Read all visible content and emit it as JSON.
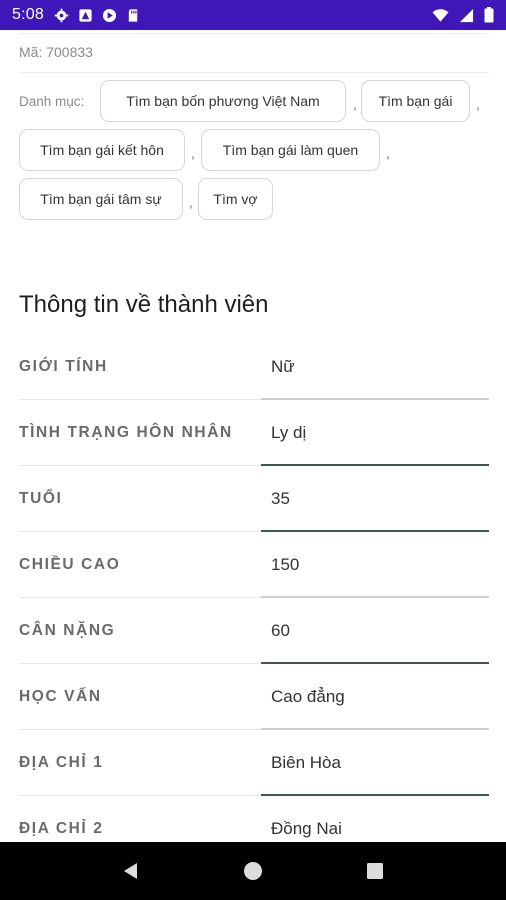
{
  "status_bar": {
    "time": "5:08"
  },
  "listing": {
    "code": "Mã: 700833",
    "category_label": "Danh mục:",
    "categories": [
      "Tìm bạn bốn phương Việt Nam",
      "Tìm bạn gái",
      "Tìm bạn gái kết hôn",
      "Tìm bạn gái làm quen",
      "Tìm bạn gái tâm sự",
      "Tìm vợ"
    ],
    "separator": ","
  },
  "member_info": {
    "title": "Thông tin về thành viên",
    "rows": [
      {
        "label": "GIỚI TÍNH",
        "value": "Nữ"
      },
      {
        "label": "TÌNH TRẠNG HÔN NHÂN",
        "value": "Ly dị"
      },
      {
        "label": "TUỔI",
        "value": "35"
      },
      {
        "label": "CHIỀU CAO",
        "value": "150"
      },
      {
        "label": "CÂN NẶNG",
        "value": "60"
      },
      {
        "label": "HỌC VẤN",
        "value": "Cao đẳng"
      },
      {
        "label": "ĐỊA CHỈ 1",
        "value": "Biên Hòa"
      },
      {
        "label": "ĐỊA CHỈ 2",
        "value": "Đồng Nai"
      }
    ]
  },
  "colors": {
    "status_bar": "#3f17b8",
    "input_underline": "#3d5a4c",
    "nav_bar": "#000000"
  }
}
